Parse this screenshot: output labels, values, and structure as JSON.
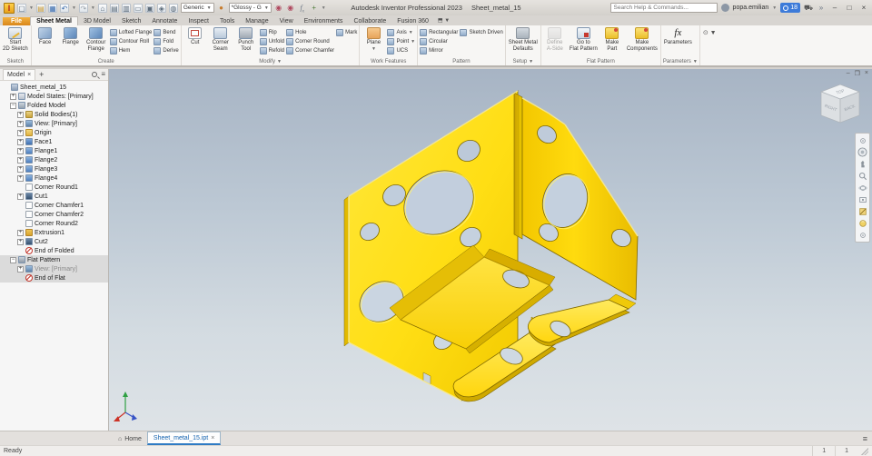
{
  "window": {
    "app_title": "Autodesk Inventor Professional 2023",
    "doc_title": "Sheet_metal_15",
    "search_placeholder": "Search Help & Commands...",
    "user": "popa.emilian",
    "trial_badge": "18",
    "material_combo": "Generic",
    "appearance_combo": "*Glossy - G"
  },
  "qat_icons": [
    "new-file-icon",
    "open-file-icon",
    "save-icon",
    "undo-icon",
    "redo-icon",
    "home-icon",
    "document-icon",
    "iproperties-icon",
    "send-icon",
    "return-icon",
    "update-icon",
    "help-globe-icon"
  ],
  "ribbon_tabs": [
    {
      "label": "File",
      "file": true
    },
    {
      "label": "Sheet Metal",
      "active": true
    },
    {
      "label": "3D Model"
    },
    {
      "label": "Sketch"
    },
    {
      "label": "Annotate"
    },
    {
      "label": "Inspect"
    },
    {
      "label": "Tools"
    },
    {
      "label": "Manage"
    },
    {
      "label": "View"
    },
    {
      "label": "Environments"
    },
    {
      "label": "Collaborate"
    },
    {
      "label": "Fusion 360"
    }
  ],
  "ribbon": {
    "groups": [
      {
        "label": "Sketch",
        "caret": false,
        "big": [
          {
            "label": "Start\n2D Sketch",
            "icon": "start-2d-sketch"
          }
        ],
        "cols": []
      },
      {
        "label": "Create",
        "caret": false,
        "big": [
          {
            "label": "Face",
            "icon": "face"
          },
          {
            "label": "Flange",
            "icon": "flange"
          },
          {
            "label": "Contour\nFlange",
            "icon": "contour-flange"
          }
        ],
        "cols": [
          [
            {
              "label": "Lofted Flange"
            },
            {
              "label": "Contour Roll"
            },
            {
              "label": "Hem"
            }
          ],
          [
            {
              "label": "Bend"
            },
            {
              "label": "Fold"
            },
            {
              "label": "Derive"
            }
          ]
        ]
      },
      {
        "label": "Modify",
        "caret": true,
        "big": [
          {
            "label": "Cut",
            "icon": "cut"
          },
          {
            "label": "Corner\nSeam",
            "icon": "corner-seam"
          },
          {
            "label": "Punch\nTool",
            "icon": "punch-tool"
          }
        ],
        "cols": [
          [
            {
              "label": "Rip"
            },
            {
              "label": "Unfold"
            },
            {
              "label": "Refold"
            }
          ],
          [
            {
              "label": "Hole"
            },
            {
              "label": "Corner Round"
            },
            {
              "label": "Corner Chamfer"
            }
          ],
          [
            {
              "label": "Mark"
            }
          ]
        ]
      },
      {
        "label": "Work Features",
        "caret": false,
        "big": [
          {
            "label": "Plane",
            "icon": "plane",
            "caret": true
          }
        ],
        "cols": [
          [
            {
              "label": "Axis",
              "caret": true
            },
            {
              "label": "Point",
              "caret": true
            },
            {
              "label": "UCS"
            }
          ]
        ]
      },
      {
        "label": "Pattern",
        "caret": false,
        "big": [],
        "cols": [
          [
            {
              "label": "Rectangular"
            },
            {
              "label": "Circular"
            },
            {
              "label": "Mirror"
            }
          ],
          [
            {
              "label": "Sketch Driven"
            }
          ]
        ]
      },
      {
        "label": "Setup",
        "caret": true,
        "big": [
          {
            "label": "Sheet Metal\nDefaults",
            "icon": "sheet-metal-defaults"
          }
        ],
        "cols": []
      },
      {
        "label": "Flat Pattern",
        "caret": false,
        "big": [
          {
            "label": "Define\nA-Side",
            "icon": "define-a-side",
            "disabled": true
          },
          {
            "label": "Go to\nFlat Pattern",
            "icon": "go-to-flat-pattern"
          },
          {
            "label": "Make\nPart",
            "icon": "make-part"
          },
          {
            "label": "Make\nComponents",
            "icon": "make-components"
          }
        ],
        "cols": []
      },
      {
        "label": "Parameters",
        "caret": true,
        "big": [
          {
            "label": "Parameters",
            "icon": "parameters"
          }
        ],
        "cols": []
      }
    ]
  },
  "browser": {
    "tab": "Model",
    "tree": [
      {
        "label": "Sheet_metal_15",
        "depth": 0,
        "expander": "",
        "icon": "part-icon"
      },
      {
        "label": "Model States: [Primary]",
        "depth": 1,
        "expander": "+",
        "icon": "model-states-icon"
      },
      {
        "label": "Folded Model",
        "depth": 1,
        "expander": "-",
        "icon": "folded-model-icon"
      },
      {
        "label": "Solid Bodies(1)",
        "depth": 2,
        "expander": "+",
        "icon": "solid-bodies-icon"
      },
      {
        "label": "View: [Primary]",
        "depth": 2,
        "expander": "+",
        "icon": "view-icon"
      },
      {
        "label": "Origin",
        "depth": 2,
        "expander": "+",
        "icon": "origin-folder-icon"
      },
      {
        "label": "Face1",
        "depth": 2,
        "expander": "+",
        "icon": "face-icon"
      },
      {
        "label": "Flange1",
        "depth": 2,
        "expander": "+",
        "icon": "flange-icon"
      },
      {
        "label": "Flange2",
        "depth": 2,
        "expander": "+",
        "icon": "flange-icon"
      },
      {
        "label": "Flange3",
        "depth": 2,
        "expander": "+",
        "icon": "flange-icon"
      },
      {
        "label": "Flange4",
        "depth": 2,
        "expander": "+",
        "icon": "flange-icon"
      },
      {
        "label": "Corner Round1",
        "depth": 2,
        "expander": "",
        "icon": "corner-round-icon"
      },
      {
        "label": "Cut1",
        "depth": 2,
        "expander": "+",
        "icon": "cut-icon"
      },
      {
        "label": "Corner Chamfer1",
        "depth": 2,
        "expander": "",
        "icon": "corner-chamfer-icon"
      },
      {
        "label": "Corner Chamfer2",
        "depth": 2,
        "expander": "",
        "icon": "corner-chamfer-icon"
      },
      {
        "label": "Corner Round2",
        "depth": 2,
        "expander": "",
        "icon": "corner-round-icon"
      },
      {
        "label": "Extrusion1",
        "depth": 2,
        "expander": "+",
        "icon": "extrusion-icon"
      },
      {
        "label": "Cut2",
        "depth": 2,
        "expander": "+",
        "icon": "cut-icon"
      },
      {
        "label": "End of Folded",
        "depth": 2,
        "expander": "",
        "icon": "end-icon"
      },
      {
        "label": "Flat Pattern",
        "depth": 1,
        "expander": "-",
        "icon": "flat-pattern-icon",
        "selected": true
      },
      {
        "label": "View: [Primary]",
        "depth": 2,
        "expander": "+",
        "icon": "view-icon",
        "selected": true,
        "dim": true
      },
      {
        "label": "End of Flat",
        "depth": 2,
        "expander": "",
        "icon": "end-icon",
        "selected": true
      }
    ]
  },
  "viewcube": {
    "top": "TOP",
    "left": "RIGHT",
    "right": "BACK"
  },
  "navbar_icons": [
    "navbar-settings-icon",
    "navigation-wheel-icon",
    "pan-icon",
    "zoom-icon",
    "orbit-icon",
    "look-at-icon",
    "section-view-icon",
    "visual-style-icon",
    "navbar-options-icon"
  ],
  "doc_tabs": {
    "home": "Home",
    "active_doc": "Sheet_metal_15.ipt",
    "close": "×"
  },
  "statusbar": {
    "message": "Ready",
    "cells": [
      "1",
      "1"
    ]
  }
}
